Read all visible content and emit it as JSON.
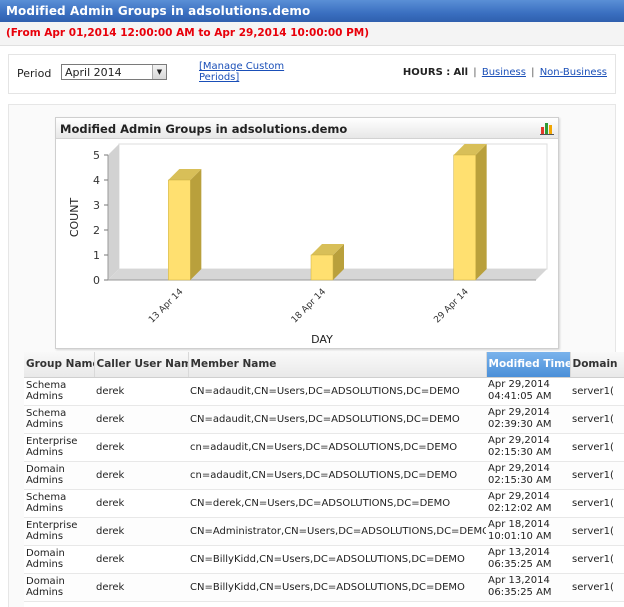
{
  "report": {
    "title": "Modified Admin Groups in adsolutions.demo",
    "date_range": "(From Apr 01,2014 12:00:00 AM to Apr 29,2014 10:00:00 PM)"
  },
  "filters": {
    "period_label": "Period",
    "period_value": "April 2014",
    "manage_link": "[Manage Custom Periods]",
    "hours_label": "HOURS :",
    "hours_all": "All",
    "hours_sep": "|",
    "hours_business": "Business",
    "hours_non_business": "Non-Business"
  },
  "chart_panel": {
    "title": "Modified Admin Groups in adsolutions.demo",
    "icon": "chart-type-icon"
  },
  "chart_data": {
    "type": "bar",
    "categories": [
      "13 Apr 14",
      "18 Apr 14",
      "29 Apr 14"
    ],
    "values": [
      4,
      1,
      5
    ],
    "xlabel": "DAY",
    "ylabel": "COUNT",
    "ylim": [
      0,
      5
    ],
    "yticks": [
      "0",
      "1",
      "2",
      "3",
      "4",
      "5"
    ],
    "bar_color": "#ffe070",
    "grid": false
  },
  "table": {
    "columns": [
      "Group Name",
      "Caller User Name",
      "Member Name",
      "Modified Time",
      "Domain"
    ],
    "sorted_column_index": 3,
    "sort_icon": "sort-desc-icon",
    "rows": [
      {
        "group": "Schema Admins",
        "caller": "derek",
        "member": "CN=adaudit,CN=Users,DC=ADSOLUTIONS,DC=DEMO",
        "time1": "Apr 29,2014",
        "time2": "04:41:05 AM",
        "domain": "server1("
      },
      {
        "group": "Schema Admins",
        "caller": "derek",
        "member": "CN=adaudit,CN=Users,DC=ADSOLUTIONS,DC=DEMO",
        "time1": "Apr 29,2014",
        "time2": "02:39:30 AM",
        "domain": "server1("
      },
      {
        "group": "Enterprise Admins",
        "caller": "derek",
        "member": "cn=adaudit,CN=Users,DC=ADSOLUTIONS,DC=DEMO",
        "time1": "Apr 29,2014",
        "time2": "02:15:30 AM",
        "domain": "server1("
      },
      {
        "group": "Domain Admins",
        "caller": "derek",
        "member": "cn=adaudit,CN=Users,DC=ADSOLUTIONS,DC=DEMO",
        "time1": "Apr 29,2014",
        "time2": "02:15:30 AM",
        "domain": "server1("
      },
      {
        "group": "Schema Admins",
        "caller": "derek",
        "member": "CN=derek,CN=Users,DC=ADSOLUTIONS,DC=DEMO",
        "time1": "Apr 29,2014",
        "time2": "02:12:02 AM",
        "domain": "server1("
      },
      {
        "group": "Enterprise Admins",
        "caller": "derek",
        "member": "CN=Administrator,CN=Users,DC=ADSOLUTIONS,DC=DEMO",
        "time1": "Apr 18,2014",
        "time2": "10:01:10 AM",
        "domain": "server1("
      },
      {
        "group": "Domain Admins",
        "caller": "derek",
        "member": "CN=BillyKidd,CN=Users,DC=ADSOLUTIONS,DC=DEMO",
        "time1": "Apr 13,2014",
        "time2": "06:35:25 AM",
        "domain": "server1("
      },
      {
        "group": "Domain Admins",
        "caller": "derek",
        "member": "CN=BillyKidd,CN=Users,DC=ADSOLUTIONS,DC=DEMO",
        "time1": "Apr 13,2014",
        "time2": "06:35:25 AM",
        "domain": "server1("
      }
    ]
  }
}
